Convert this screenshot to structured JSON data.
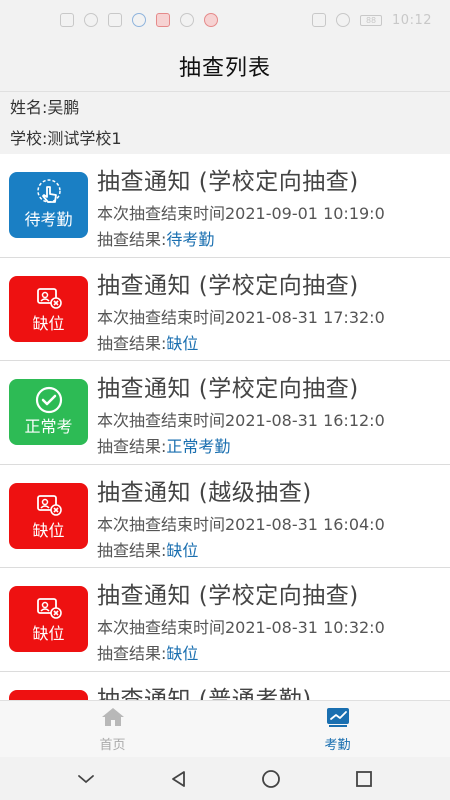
{
  "status_bar": {
    "time": "10:12",
    "battery": "88"
  },
  "header": {
    "title": "抽查列表"
  },
  "info": {
    "name": "姓名:吴鹏",
    "school": "学校:测试学校1"
  },
  "list": {
    "items": [
      {
        "badge": "待考勤",
        "badge_color": "#1a7fc4",
        "icon": "hand-tap-icon",
        "title": "抽查通知 (学校定向抽查)",
        "time": "本次抽查结束时间2021-09-01 10:19:0",
        "result_label": "抽查结果:",
        "result": "待考勤"
      },
      {
        "badge": "缺位",
        "badge_color": "#ee1111",
        "icon": "id-card-absent-icon",
        "title": "抽查通知 (学校定向抽查)",
        "time": "本次抽查结束时间2021-08-31 17:32:0",
        "result_label": "抽查结果:",
        "result": "缺位"
      },
      {
        "badge": "正常考",
        "badge_color": "#2dbb55",
        "icon": "check-circle-icon",
        "title": "抽查通知 (学校定向抽查)",
        "time": "本次抽查结束时间2021-08-31 16:12:0",
        "result_label": "抽查结果:",
        "result": "正常考勤"
      },
      {
        "badge": "缺位",
        "badge_color": "#ee1111",
        "icon": "id-card-absent-icon",
        "title": "抽查通知 (越级抽查)",
        "time": "本次抽查结束时间2021-08-31 16:04:0",
        "result_label": "抽查结果:",
        "result": "缺位"
      },
      {
        "badge": "缺位",
        "badge_color": "#ee1111",
        "icon": "id-card-absent-icon",
        "title": "抽查通知 (学校定向抽查)",
        "time": "本次抽查结束时间2021-08-31 10:32:0",
        "result_label": "抽查结果:",
        "result": "缺位"
      },
      {
        "badge": "",
        "badge_color": "#ee1111",
        "icon": "id-card-absent-icon",
        "title": "抽查通知 (普通考勤)",
        "time": "",
        "result_label": "",
        "result": ""
      }
    ]
  },
  "bottom_nav": {
    "home_label": "首页",
    "attendance_label": "考勤",
    "active": "attendance",
    "accent_color": "#1a6fb0"
  }
}
